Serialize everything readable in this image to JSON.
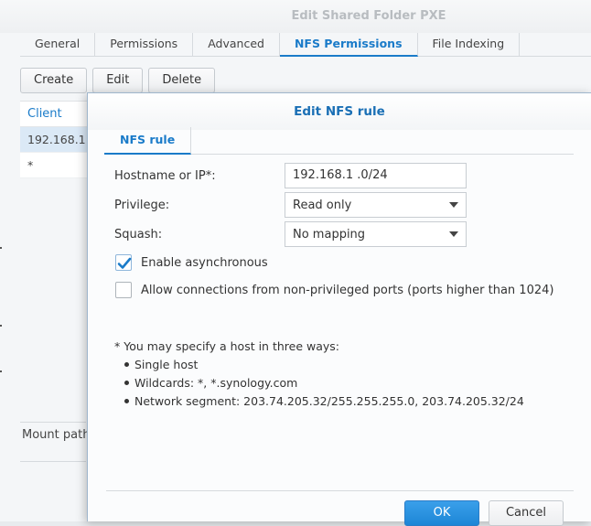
{
  "background_dialog": {
    "title": "Edit Shared Folder PXE",
    "tabs": [
      {
        "label": "General"
      },
      {
        "label": "Permissions"
      },
      {
        "label": "Advanced"
      },
      {
        "label": "NFS Permissions",
        "active": true
      },
      {
        "label": "File Indexing"
      }
    ],
    "toolbar": {
      "create_label": "Create",
      "edit_label": "Edit",
      "delete_label": "Delete"
    },
    "table": {
      "column_client": "Client",
      "rows": [
        "192.168.1",
        "*"
      ]
    },
    "mount_path_label": "Mount path"
  },
  "modal": {
    "title": "Edit NFS rule",
    "tab_label": "NFS rule",
    "hostname_label": "Hostname or IP*:",
    "hostname_value": "192.168.1  .0/24",
    "privilege_label": "Privilege:",
    "privilege_value": "Read only",
    "squash_label": "Squash:",
    "squash_value": "No mapping",
    "enable_async_label": "Enable asynchronous",
    "enable_async_checked": true,
    "allow_ports_label": "Allow connections from non-privileged ports (ports higher than 1024)",
    "allow_ports_checked": false,
    "note_heading": "* You may specify a host in three ways:",
    "note_items": [
      "Single host",
      "Wildcards: *, *.synology.com",
      "Network segment: 203.74.205.32/255.255.255.0, 203.74.205.32/24"
    ],
    "ok_label": "OK",
    "cancel_label": "Cancel"
  },
  "colors": {
    "accent": "#1a7bc9",
    "ok_button": "#1d86d6",
    "selected_row": "#dbe9f6"
  }
}
